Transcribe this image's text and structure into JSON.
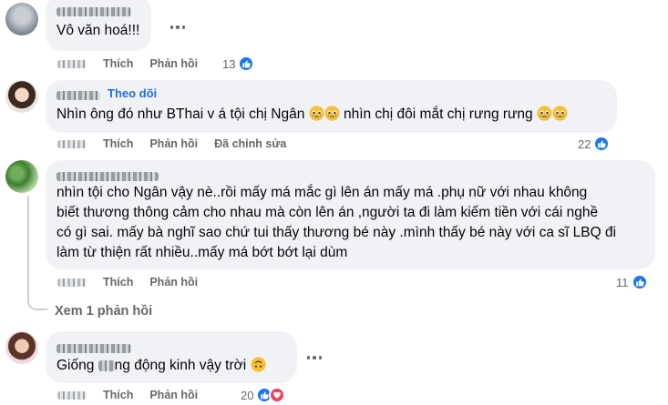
{
  "comments": [
    {
      "author_visible": "",
      "text": "Vô văn hoá!!!",
      "like_label": "Thích",
      "reply_label": "Phản hồi",
      "reaction_count": "13",
      "reactions": [
        "like"
      ]
    },
    {
      "author_visible": "",
      "follow_label": "Theo dõi",
      "text": "Nhìn ông đó như BThai v á tội chị Ngân",
      "text_after_emoji": "nhìn chị đôi mắt chị rưng rưng",
      "like_label": "Thích",
      "reply_label": "Phản hồi",
      "edited_label": "Đã chỉnh sửa",
      "reaction_count": "22",
      "reactions": [
        "like"
      ]
    },
    {
      "author_visible": "",
      "text_lines": [
        "nhìn tội cho Ngân vậy nè..rồi mấy má mắc gì lên án mấy má .phụ nữ với nhau không",
        "biết thương thông cảm cho nhau mà còn lên án ,người ta đi làm kiếm tiền với cái nghề",
        "có gì sai. mấy bà nghĩ sao chứ tui thấy thương bé này .mình thấy bé này với ca sĩ LBQ đi",
        "làm từ thiện rất nhiều..mấy má bớt bớt lại dùm"
      ],
      "like_label": "Thích",
      "reply_label": "Phản hồi",
      "reaction_count": "11",
      "reactions": [
        "like"
      ],
      "view_replies_label": "Xem 1 phản hồi"
    },
    {
      "author_visible": "",
      "text_start": "Giống ",
      "text_end": "ng động kinh vậy trời",
      "like_label": "Thích",
      "reply_label": "Phản hồi",
      "reaction_count": "20",
      "reactions": [
        "like",
        "love"
      ]
    }
  ],
  "colors": {
    "bubble": "#f0f2f5",
    "follow": "#216fdb",
    "like": "#1877f2",
    "love": "#f33e58",
    "meta": "#65676b"
  }
}
